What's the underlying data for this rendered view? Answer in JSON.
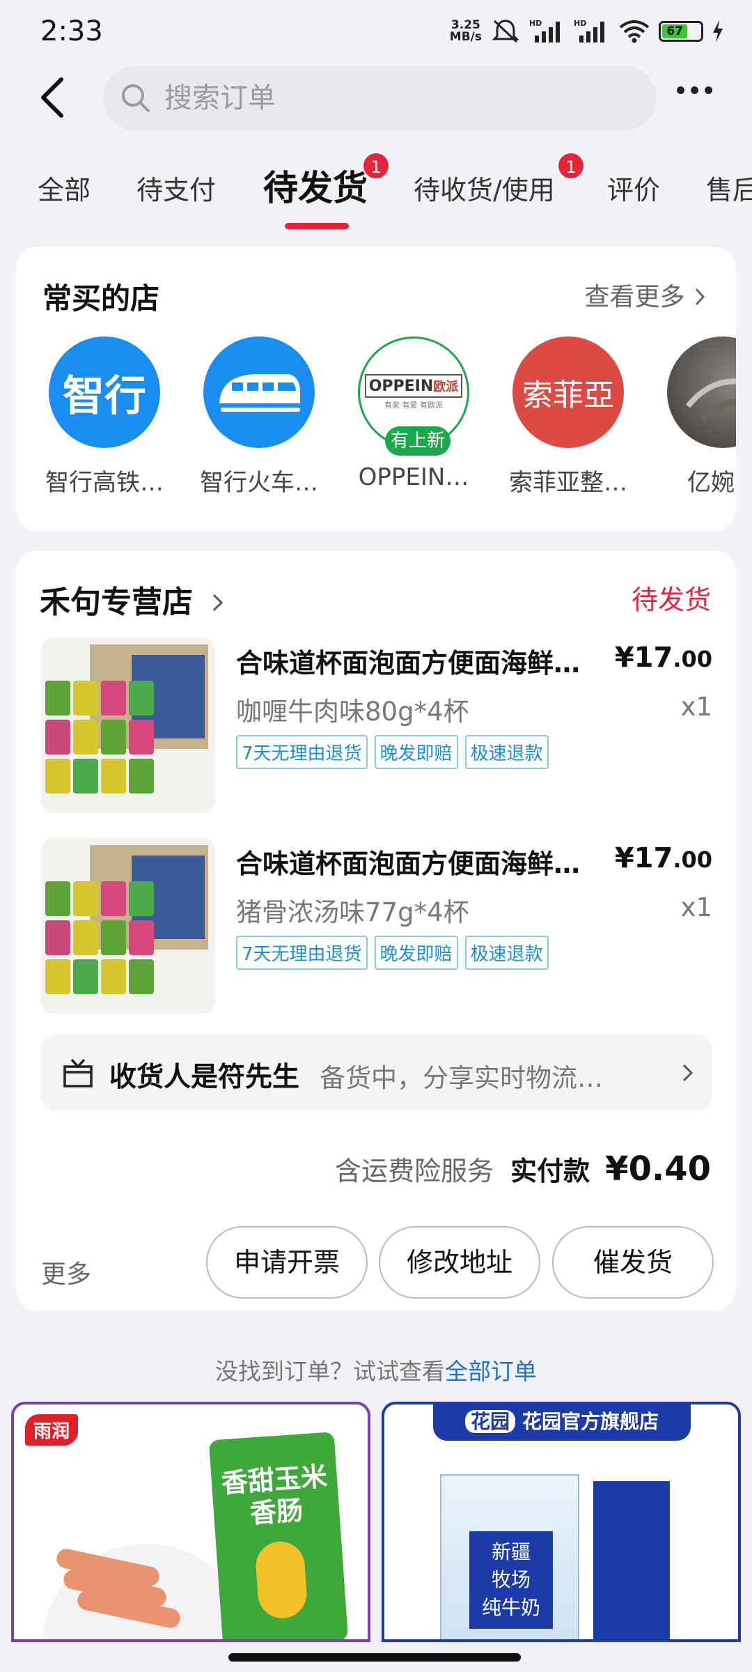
{
  "status_bar": {
    "time": "2:33",
    "net_speed_value": "3.25",
    "net_speed_unit": "MB/s",
    "battery_level": "67",
    "battery_color": "#3cc43c"
  },
  "header": {
    "search_placeholder": "搜索订单"
  },
  "tabs": [
    {
      "label": "全部"
    },
    {
      "label": "待支付"
    },
    {
      "label": "待发货",
      "badge": "1"
    },
    {
      "label": "待收货/使用",
      "badge": "1"
    },
    {
      "label": "评价"
    },
    {
      "label": "售后"
    }
  ],
  "frequent_stores": {
    "title": "常买的店",
    "see_more": "查看更多",
    "stores": [
      {
        "name": "智行高铁…",
        "logo_text": "智行",
        "icon": "zhixing-logo"
      },
      {
        "name": "智行火车…",
        "icon": "train-logo"
      },
      {
        "name": "OPPEIN…",
        "logo_text": "OPPEIN",
        "logo_text_cn": "欧派",
        "logo_slogan": "有家 有爱 有欧派",
        "new_tag": "有上新",
        "icon": "oppein-logo"
      },
      {
        "name": "索菲亚整…",
        "logo_text": "索菲亞",
        "icon": "sofia-logo"
      },
      {
        "name": "亿婉…",
        "icon": "store-photo"
      }
    ]
  },
  "order": {
    "shop_name": "禾句专营店",
    "status": "待发货",
    "items": [
      {
        "title": "合味道杯面泡面方便面海鲜…",
        "price_main": "¥17",
        "price_decimal": ".00",
        "spec": "咖喱牛肉味80g*4杯",
        "qty": "x1",
        "tags": [
          "7天无理由退货",
          "晚发即赔",
          "极速退款"
        ]
      },
      {
        "title": "合味道杯面泡面方便面海鲜…",
        "price_main": "¥17",
        "price_decimal": ".00",
        "spec": "猪骨浓汤味77g*4杯",
        "qty": "x1",
        "tags": [
          "7天无理由退货",
          "晚发即赔",
          "极速退款"
        ]
      }
    ],
    "receiver_label": "收货人是符先生",
    "receiver_hint": "备货中，分享实时物流…",
    "insurance_text": "含运费险服务",
    "paid_label": "实付款",
    "paid_amount": "¥0.40",
    "more": "更多",
    "buttons": [
      "申请开票",
      "修改地址",
      "催发货"
    ]
  },
  "footer": {
    "not_found_text": "没找到订单？试试查看",
    "all_orders_link": "全部订单"
  },
  "promos": [
    {
      "brand": "雨润",
      "product_line1": "香甜玉米",
      "product_line2": "香肠"
    },
    {
      "brand": "花园",
      "banner": "花园官方旗舰店",
      "product_line1": "新疆",
      "product_line2": "牧场",
      "product_line3": "纯牛奶"
    }
  ],
  "colors": {
    "accent": "#e5243b",
    "link": "#1d6fd1",
    "tag_blue": "#1a8ed6",
    "new_green": "#1aa84d"
  }
}
